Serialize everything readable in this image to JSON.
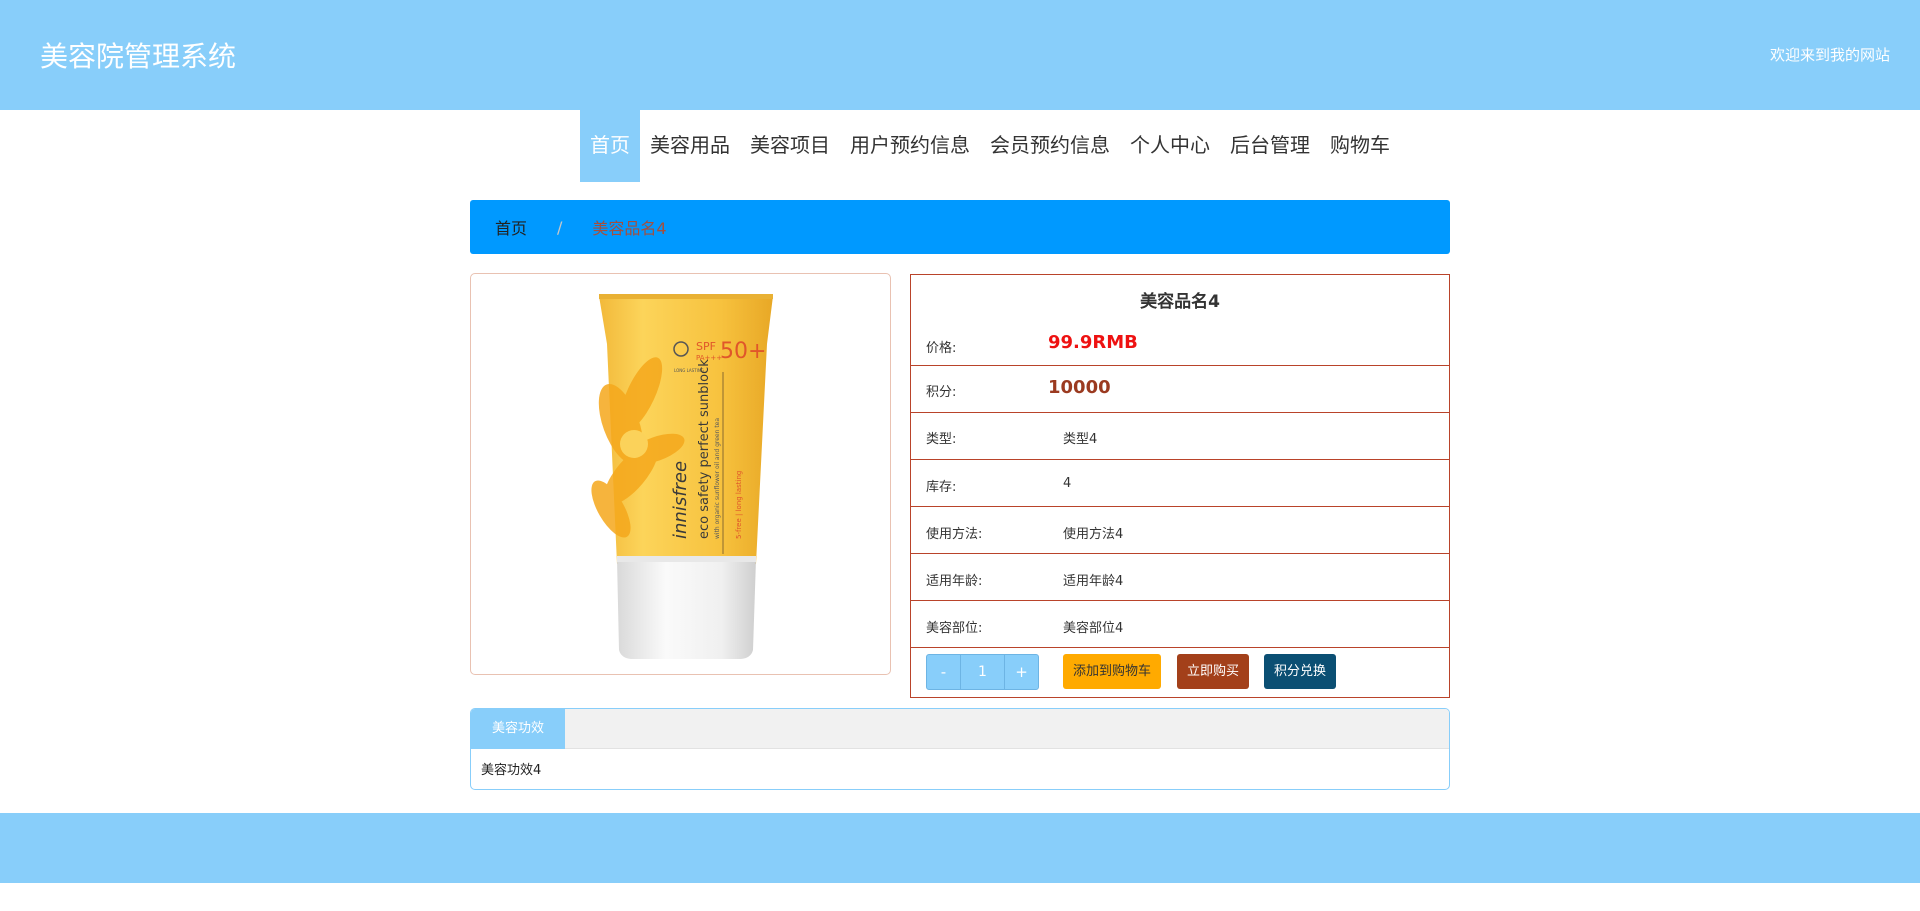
{
  "header": {
    "site_title": "美容院管理系统",
    "welcome": "欢迎来到我的网站"
  },
  "nav": {
    "items": [
      {
        "label": "首页",
        "active": true
      },
      {
        "label": "美容用品"
      },
      {
        "label": "美容项目"
      },
      {
        "label": "用户预约信息"
      },
      {
        "label": "会员预约信息"
      },
      {
        "label": "个人中心"
      },
      {
        "label": "后台管理"
      },
      {
        "label": "购物车"
      }
    ]
  },
  "breadcrumb": {
    "home": "首页",
    "separator": "/",
    "current": "美容品名4"
  },
  "product": {
    "name": "美容品名4",
    "image_brand": "innisfree",
    "image_line1": "eco safety perfect sunblock",
    "image_line2": "with organic sunflower oil and green tea",
    "image_line3": "5-free | long lasting",
    "image_spf": "SPF",
    "image_pa": "PA+++",
    "image_spf_value": "50+",
    "image_long_lasting": "LONG LASTING",
    "price_label": "价格:",
    "price_value": "99.9RMB",
    "points_label": "积分:",
    "points_value": "10000",
    "type_label": "类型:",
    "type_value": "类型4",
    "stock_label": "库存:",
    "stock_value": "4",
    "usage_label": "使用方法:",
    "usage_value": "使用方法4",
    "age_label": "适用年龄:",
    "age_value": "适用年龄4",
    "part_label": "美容部位:",
    "part_value": "美容部位4"
  },
  "actions": {
    "minus": "-",
    "quantity": "1",
    "plus": "+",
    "add_cart": "添加到购物车",
    "buy_now": "立即购买",
    "exchange": "积分兑换"
  },
  "tabs": {
    "effect_tab": "美容功效",
    "effect_content": "美容功效4"
  },
  "colors": {
    "header_bg": "#88cefa",
    "breadcrumb_bg": "#0099ff",
    "cart_btn": "#ffaa00",
    "buy_btn": "#a3401a",
    "exchange_btn": "#0b4f73",
    "price": "#ee1111"
  }
}
